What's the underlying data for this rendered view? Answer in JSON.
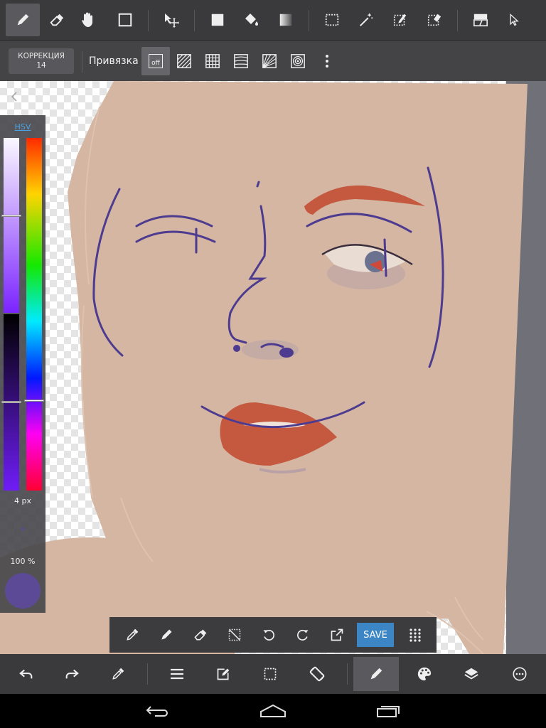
{
  "toolbar": {
    "tools": [
      "pen-icon",
      "eraser-icon",
      "hand-icon",
      "rectangle-icon",
      "move-icon",
      "fill-square-icon",
      "bucket-icon",
      "gradient-icon",
      "select-rect-icon",
      "magic-wand-icon",
      "select-pen-icon",
      "select-eraser-icon",
      "layer-split-icon",
      "pointer-icon"
    ],
    "active_tool": "pen"
  },
  "subbar": {
    "correction_label": "КОРРЕКЦИЯ",
    "correction_value": "14",
    "snap_label": "Привязка",
    "snap_off_label": "off"
  },
  "left_panel": {
    "mode_label": "HSV",
    "brush_size": "4 px",
    "opacity": "100 %",
    "current_color": "#5d4a97"
  },
  "float_bar": {
    "save_label": "SAVE"
  },
  "colors": {
    "skin": "#d4b6a2",
    "sketch": "#4d3b8f",
    "lips": "#c5593f",
    "accent": "#3d86c6"
  }
}
